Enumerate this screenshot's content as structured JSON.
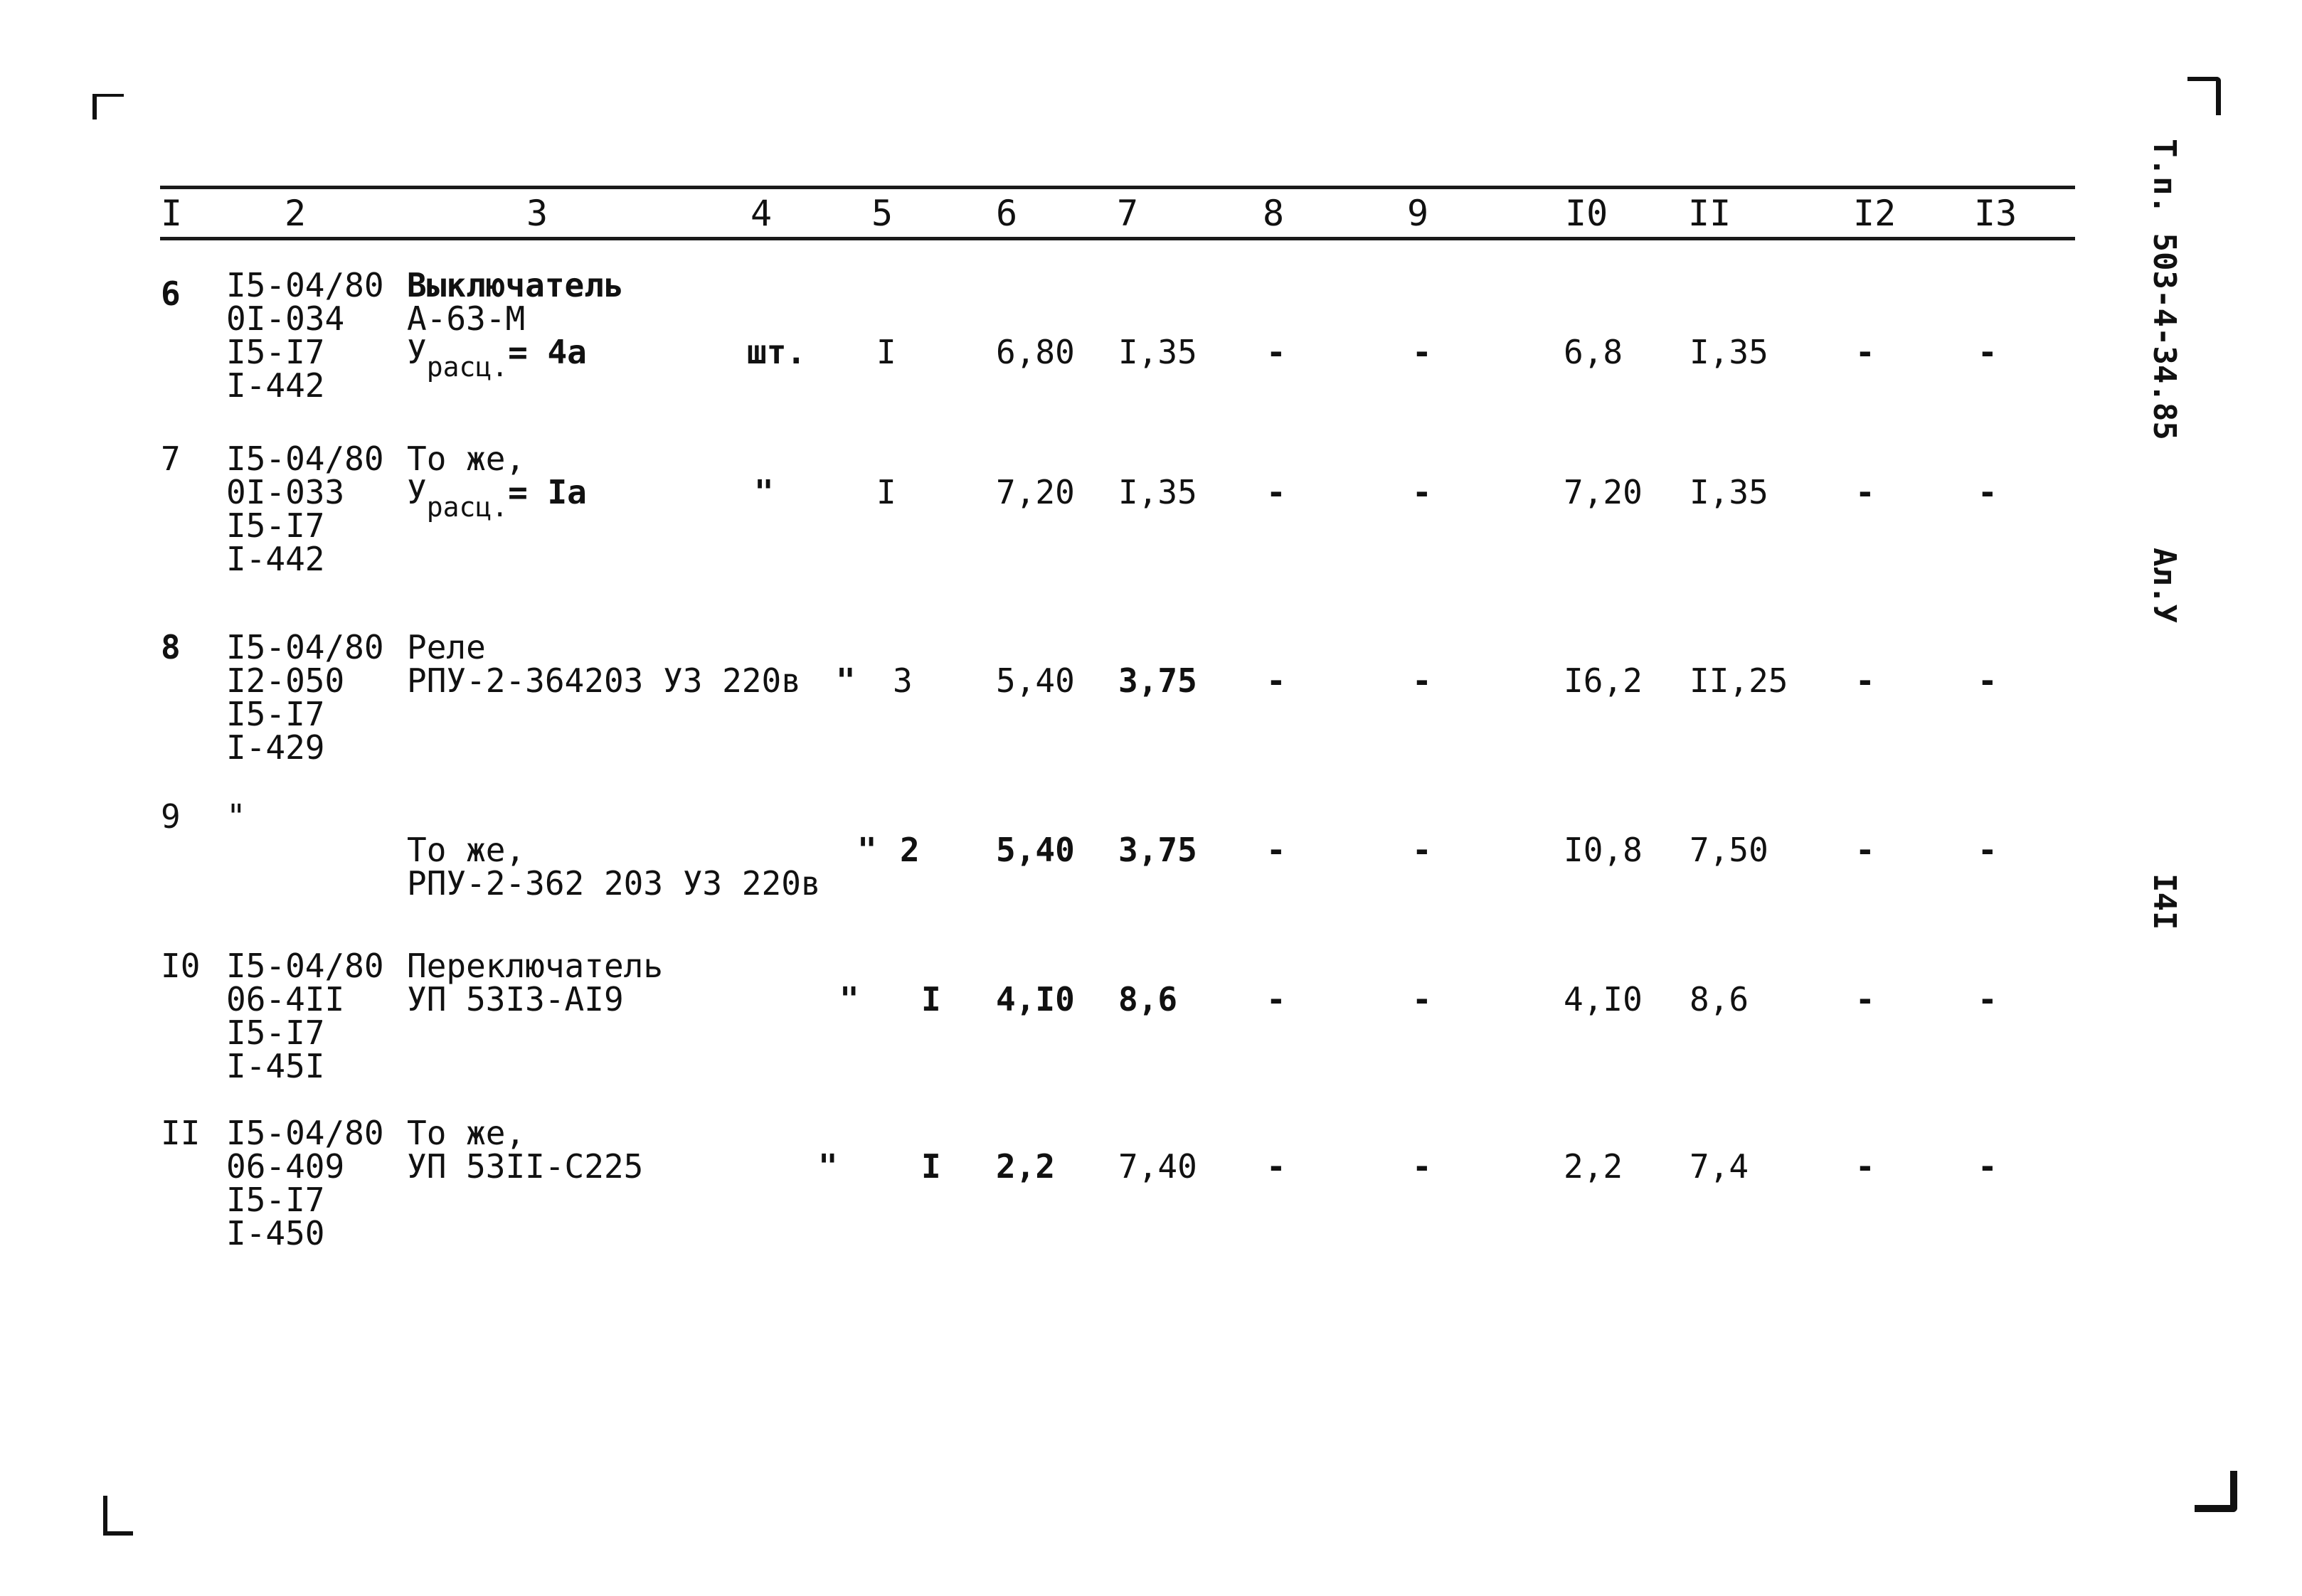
{
  "document": {
    "side_title": "Т.п. 503-4-34.85",
    "album": "Ал.У",
    "page_number": "I4I"
  },
  "table": {
    "columns": [
      "I",
      "2",
      "3",
      "4",
      "5",
      "6",
      "7",
      "8",
      "9",
      "I0",
      "II",
      "I2",
      "I3"
    ],
    "rows": [
      {
        "num": "6",
        "code": [
          "I5-04/80",
          "0I-034",
          "I5-I7",
          "I-442"
        ],
        "name": [
          "Выключатель",
          "А-63-М"
        ],
        "name_sub_prefix": "У",
        "name_sub": "расц.",
        "name_sub_value": "= 4а",
        "unit": "шт.",
        "qty": "I",
        "c6": "6,80",
        "c7": "I,35",
        "c8": "-",
        "c9": "-",
        "c10": "6,8",
        "c11": "I,35",
        "c12": "-",
        "c13": "-"
      },
      {
        "num": "7",
        "code": [
          "I5-04/80",
          "0I-033",
          "I5-I7",
          "I-442"
        ],
        "name": [
          "То же,"
        ],
        "name_sub_prefix": "У",
        "name_sub": "расц.",
        "name_sub_value": "= Iа",
        "unit": "\"",
        "qty": "I",
        "c6": "7,20",
        "c7": "I,35",
        "c8": "-",
        "c9": "-",
        "c10": "7,20",
        "c11": "I,35",
        "c12": "-",
        "c13": "-"
      },
      {
        "num": "8",
        "code": [
          "I5-04/80",
          "I2-050",
          "I5-I7",
          "I-429"
        ],
        "name": [
          "Реле",
          "РПУ-2-364203 У3 220в"
        ],
        "unit": "\"",
        "qty": "3",
        "c6": "5,40",
        "c7": "3,75",
        "c8": "-",
        "c9": "-",
        "c10": "I6,2",
        "c11": "II,25",
        "c12": "-",
        "c13": "-"
      },
      {
        "num": "9",
        "code": [
          "\""
        ],
        "name": [
          "То же,",
          "РПУ-2-362 203 У3 220в"
        ],
        "unit": "\"",
        "qty": "2",
        "c6": "5,40",
        "c7": "3,75",
        "c8": "-",
        "c9": "-",
        "c10": "I0,8",
        "c11": "7,50",
        "c12": "-",
        "c13": "-"
      },
      {
        "num": "I0",
        "code": [
          "I5-04/80",
          "06-4II",
          "I5-I7",
          "I-45I"
        ],
        "name": [
          "Переключатель",
          "УП 53I3-АI9"
        ],
        "unit": "\"",
        "qty": "I",
        "c6": "4,I0",
        "c7": "8,6",
        "c8": "-",
        "c9": "-",
        "c10": "4,I0",
        "c11": "8,6",
        "c12": "-",
        "c13": "-"
      },
      {
        "num": "II",
        "code": [
          "I5-04/80",
          "06-409",
          "I5-I7",
          "I-450"
        ],
        "name": [
          "То же,",
          "УП 53II-С225"
        ],
        "unit": "\"",
        "qty": "I",
        "c6": "2,2",
        "c7": "7,40",
        "c8": "-",
        "c9": "-",
        "c10": "2,2",
        "c11": "7,4",
        "c12": "-",
        "c13": "-"
      }
    ]
  }
}
